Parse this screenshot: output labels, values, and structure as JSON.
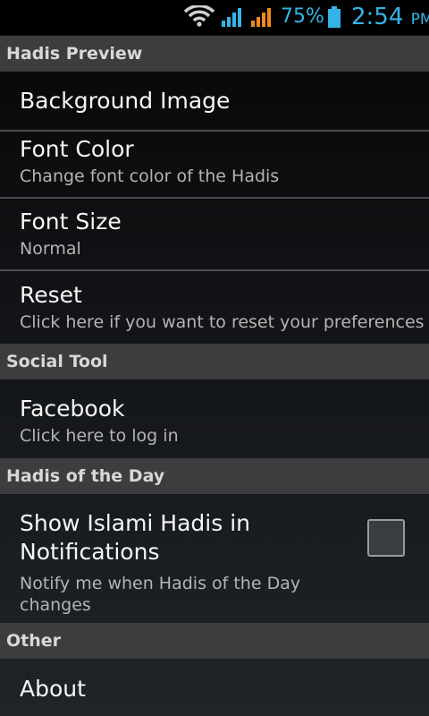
{
  "status_bar": {
    "battery_percent": "75%",
    "time": "2:54",
    "ampm": "PM",
    "accent_color": "#34b4e6",
    "icons": [
      "wifi-icon",
      "signal-icon",
      "signal-icon",
      "battery-icon"
    ]
  },
  "preferences": {
    "hadis_preview": {
      "header": "Hadis Preview",
      "background_image": {
        "title": "Background Image"
      },
      "font_color": {
        "title": "Font Color",
        "summary": "Change font color of the Hadis"
      },
      "font_size": {
        "title": "Font Size",
        "summary": "Normal"
      },
      "reset": {
        "title": "Reset",
        "summary": "Click here if you want to reset your preferences"
      }
    },
    "social_tool": {
      "header": "Social Tool",
      "facebook": {
        "title": "Facebook",
        "summary": "Click here to log in"
      }
    },
    "hadis_of_the_day": {
      "header": "Hadis of the Day",
      "notifications": {
        "title": "Show Islami Hadis in Notifications",
        "summary": "Notify me when Hadis of the Day changes",
        "checked": false
      }
    },
    "other": {
      "header": "Other",
      "about": {
        "title": "About"
      }
    }
  }
}
